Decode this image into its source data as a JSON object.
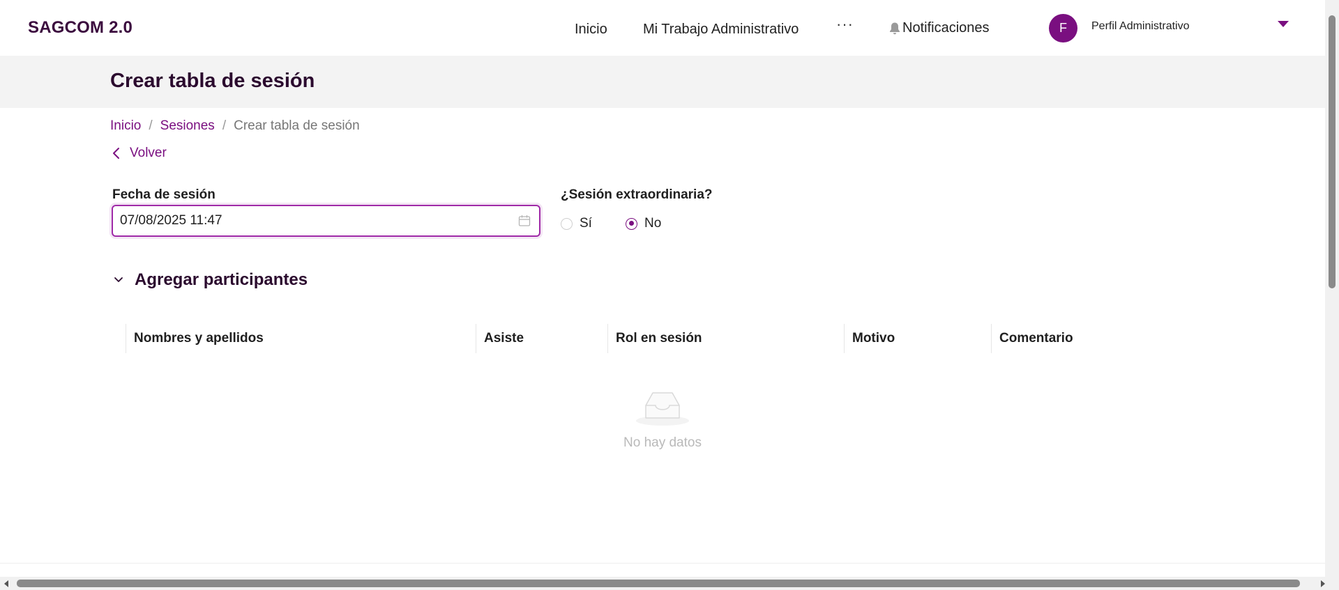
{
  "header": {
    "brand": "SAGCOM 2.0",
    "nav": [
      "Inicio",
      "Mi Trabajo Administrativo"
    ],
    "more": "···",
    "notifications": "Notificaciones",
    "avatar_initial": "F",
    "profile_name": "Perfil Administrativo",
    "accent": "#7a0f80"
  },
  "page": {
    "title": "Crear tabla de sesión",
    "breadcrumb": [
      "Inicio",
      "Sesiones",
      "Crear tabla de sesión"
    ],
    "breadcrumb_separator": "/",
    "back_label": "Volver"
  },
  "form": {
    "date_label": "Fecha de sesión",
    "date_value": "07/08/2025 11:47",
    "extraordinary_label": "¿Sesión extraordinaria?",
    "options": [
      "Sí",
      "No"
    ],
    "selected_option": "No"
  },
  "participants": {
    "section_title": "Agregar participantes",
    "columns": [
      "Nombres y apellidos",
      "Asiste",
      "Rol en sesión",
      "Motivo",
      "Comentario"
    ],
    "rows": [],
    "empty_text": "No hay datos"
  }
}
